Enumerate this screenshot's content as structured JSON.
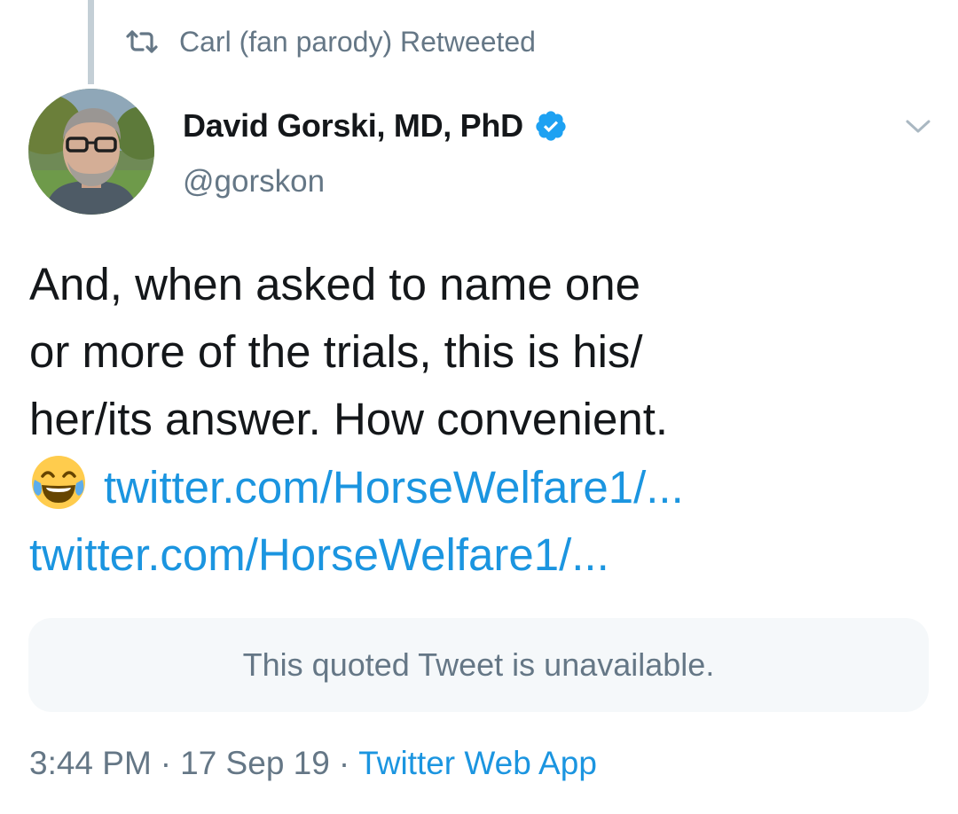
{
  "social_context": {
    "retweeted_by_text": "Carl (fan parody) Retweeted",
    "icon": "retweet-icon"
  },
  "author": {
    "display_name": "David Gorski, MD, PhD",
    "handle": "@gorskon",
    "verified": true,
    "verified_icon": "verified-badge-icon"
  },
  "tweet": {
    "lines": [
      "And, when asked to name one",
      "or more of the trials, this is his/",
      "her/its answer. How convenient."
    ],
    "emoji": "face-with-tears-of-joy",
    "links": [
      "twitter.com/HorseWelfare1/...",
      "twitter.com/HorseWelfare1/..."
    ]
  },
  "quoted_tweet": {
    "unavailable_text": "This quoted Tweet is unavailable."
  },
  "meta": {
    "time": "3:44 PM",
    "date": "17 Sep 19",
    "separator": "·",
    "source": "Twitter Web App"
  },
  "colors": {
    "link": "#1b95e0",
    "secondary_text": "#657786",
    "primary_text": "#14171a",
    "quote_bg": "#f5f8fa",
    "thread_line": "#c4cfd6"
  }
}
